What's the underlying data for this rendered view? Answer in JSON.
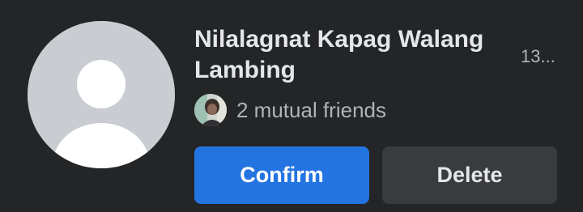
{
  "friend_request": {
    "name": "Nilalagnat Kapag Walang Lambing",
    "time": "13...",
    "avatar_icon": "default-profile-silhouette-icon",
    "mutual_friends_text": "2 mutual friends",
    "mutual_friend_avatar_icon": "mutual-friend-photo-icon",
    "confirm_label": "Confirm",
    "delete_label": "Delete"
  },
  "colors": {
    "background": "#242526",
    "confirm_button": "#2374e1",
    "delete_button": "#3a3b3c",
    "primary_text": "#e4e6eb",
    "secondary_text": "#b0b3b8",
    "avatar_placeholder": "#c9ccd1"
  }
}
